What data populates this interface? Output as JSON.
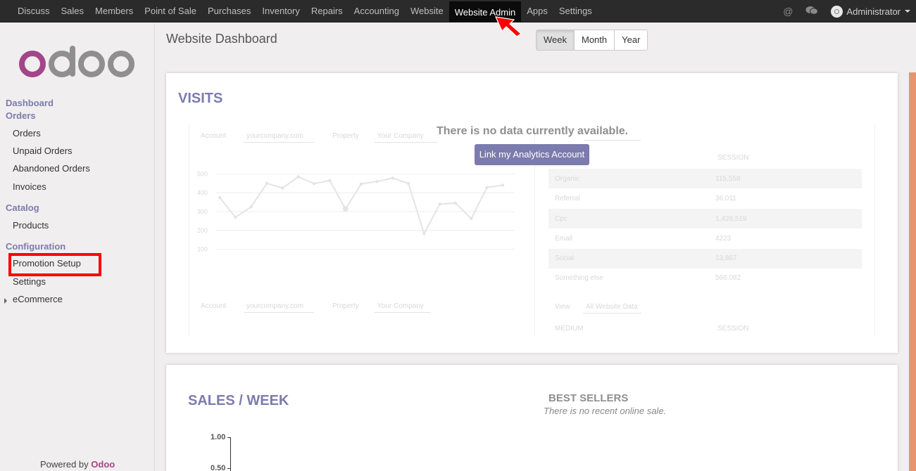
{
  "topbar": {
    "menu": [
      {
        "label": "Discuss"
      },
      {
        "label": "Sales"
      },
      {
        "label": "Members"
      },
      {
        "label": "Point of Sale"
      },
      {
        "label": "Purchases"
      },
      {
        "label": "Inventory"
      },
      {
        "label": "Repairs"
      },
      {
        "label": "Accounting"
      },
      {
        "label": "Website"
      },
      {
        "label": "Website Admin",
        "active": true
      },
      {
        "label": "Apps"
      },
      {
        "label": "Settings"
      }
    ],
    "user_name": "Administrator",
    "icons": [
      "at-icon",
      "chat-icon"
    ]
  },
  "sidebar": {
    "logo_text": "odoo",
    "sections": {
      "dashboard": "Dashboard",
      "orders": "Orders",
      "catalog": "Catalog",
      "configuration": "Configuration"
    },
    "items": {
      "orders": "Orders",
      "unpaid_orders": "Unpaid Orders",
      "abandoned_orders": "Abandoned Orders",
      "invoices": "Invoices",
      "products": "Products",
      "promotion_setup": "Promotion Setup",
      "settings": "Settings",
      "ecommerce": "eCommerce"
    },
    "powered_by": "Powered by",
    "powered_brand": "Odoo"
  },
  "header": {
    "title": "Website Dashboard",
    "periods": [
      "Week",
      "Month",
      "Year"
    ],
    "active_period": "Week"
  },
  "visits": {
    "title": "VISITS",
    "no_data": "There is no data currently available.",
    "link_button": "Link my Analytics Account",
    "placeholder": {
      "account_label": "Account",
      "account_value": "yourcompany.com",
      "property_label": "Property",
      "property_value": "Your Company",
      "y_ticks": [
        "500",
        "400",
        "300",
        "200",
        "100"
      ],
      "line_values": [
        375,
        270,
        325,
        450,
        425,
        485,
        448,
        465,
        315,
        447,
        460,
        478,
        450,
        183,
        340,
        345,
        263,
        428,
        440
      ],
      "table_header": [
        "",
        "SESSION"
      ],
      "table_rows": [
        [
          "Organic",
          "115,558"
        ],
        [
          "Referral",
          "36,011"
        ],
        [
          "Cpc",
          "1,426,519"
        ],
        [
          "Email",
          "4223"
        ],
        [
          "Social",
          "13,867"
        ],
        [
          "Something else",
          "566,082"
        ]
      ],
      "view_label": "View",
      "view_value": "All Website Data",
      "table2_header": [
        "MEDIUM",
        "SESSION"
      ]
    }
  },
  "sales": {
    "title": "SALES / WEEK",
    "y_ticks": [
      "1.00",
      "0.50"
    ],
    "best_sellers_title": "BEST SELLERS",
    "best_sellers_empty": "There is no recent online sale."
  },
  "colors": {
    "accent": "#7c7bad",
    "brand": "#a24689",
    "annotation": "#ff0000",
    "topbar_bg": "#2b2b2b"
  }
}
